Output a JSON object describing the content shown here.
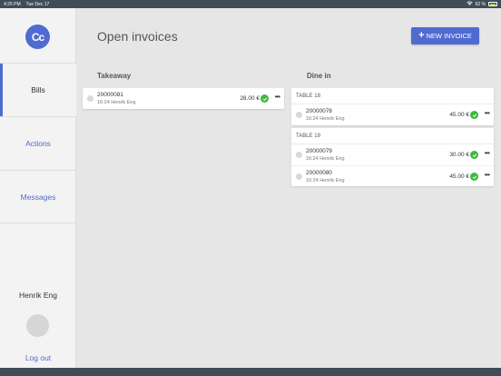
{
  "status": {
    "time": "4:25 PM",
    "date": "Tue Dec 17",
    "battery": "62 %"
  },
  "sidebar": {
    "logo": "Cc",
    "items": [
      {
        "label": "Bills",
        "active": true
      },
      {
        "label": "Actions",
        "active": false
      },
      {
        "label": "Messages",
        "active": false
      }
    ],
    "user_name": "Henrik Eng",
    "logout": "Log out"
  },
  "header": {
    "title": "Open invoices",
    "new_invoice_label": "NEW INVOICE"
  },
  "takeaway": {
    "title": "Takeaway",
    "invoices": [
      {
        "number": "20000081",
        "meta": "16:24 Henrik Eng",
        "amount": "28.00 €"
      }
    ]
  },
  "dine_in": {
    "title": "Dine in",
    "tables": [
      {
        "name": "TABLE 18",
        "invoices": [
          {
            "number": "20000078",
            "meta": "16:24 Henrik Eng",
            "amount": "45.00 €"
          }
        ]
      },
      {
        "name": "TABLE 19",
        "invoices": [
          {
            "number": "20000079",
            "meta": "16:24 Henrik Eng",
            "amount": "30.00 €"
          },
          {
            "number": "20000080",
            "meta": "16:24 Henrik Eng",
            "amount": "45.00 €"
          }
        ]
      }
    ]
  },
  "colors": {
    "accent": "#4f6bd2",
    "check": "#3dbb3d",
    "bars": "#3f4d58"
  }
}
